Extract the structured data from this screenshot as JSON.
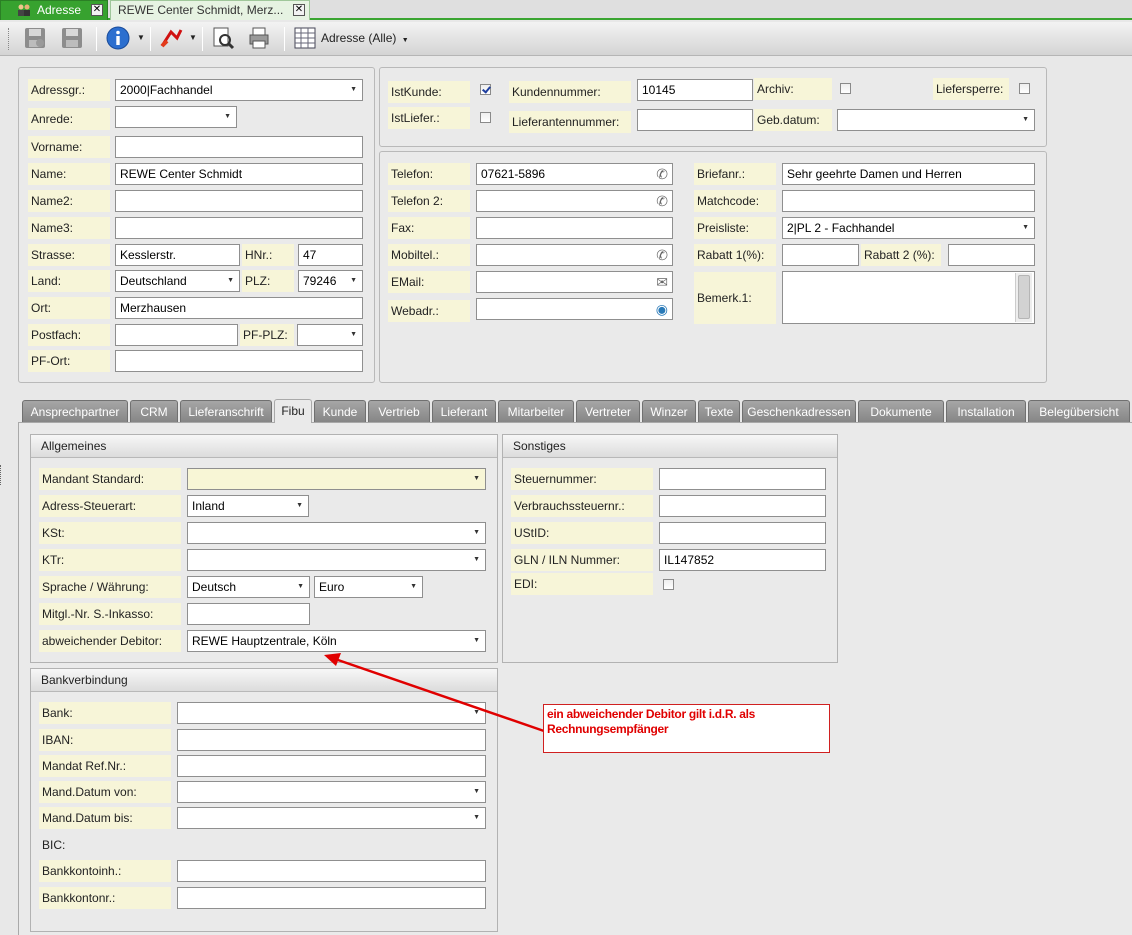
{
  "tabs": {
    "adresse": "Adresse",
    "rewe": "REWE Center Schmidt, Merz..."
  },
  "toolbar": {
    "view_dropdown": "Adresse (Alle)"
  },
  "left": {
    "adressgr_label": "Adressgr.:",
    "adressgr_value": "2000|Fachhandel",
    "anrede_label": "Anrede:",
    "anrede_value": "",
    "vorname_label": "Vorname:",
    "vorname_value": "",
    "name_label": "Name:",
    "name_value": "REWE Center Schmidt",
    "name2_label": "Name2:",
    "name2_value": "",
    "name3_label": "Name3:",
    "name3_value": "",
    "strasse_label": "Strasse:",
    "strasse_value": "Kesslerstr.",
    "hnr_label": "HNr.:",
    "hnr_value": "47",
    "land_label": "Land:",
    "land_value": "Deutschland",
    "plz_label": "PLZ:",
    "plz_value": "79246",
    "ort_label": "Ort:",
    "ort_value": "Merzhausen",
    "postfach_label": "Postfach:",
    "postfach_value": "",
    "pfplz_label": "PF-PLZ:",
    "pfplz_value": "",
    "pfort_label": "PF-Ort:",
    "pfort_value": ""
  },
  "top": {
    "istkunde_label": "IstKunde:",
    "istkunde_checked": true,
    "istliefer_label": "IstLiefer.:",
    "istliefer_checked": false,
    "kundennummer_label": "Kundennummer:",
    "kundennummer_value": "10145",
    "lieferantennummer_label": "Lieferantennummer:",
    "lieferantennummer_value": "",
    "archiv_label": "Archiv:",
    "archiv_checked": false,
    "gebdatum_label": "Geb.datum:",
    "gebdatum_value": "",
    "liefersperre_label": "Liefersperre:",
    "liefersperre_checked": false
  },
  "contact": {
    "telefon_label": "Telefon:",
    "telefon_value": "07621-5896",
    "telefon2_label": "Telefon 2:",
    "telefon2_value": "",
    "fax_label": "Fax:",
    "fax_value": "",
    "mobil_label": "Mobiltel.:",
    "mobil_value": "",
    "email_label": "EMail:",
    "email_value": "",
    "web_label": "Webadr.:",
    "web_value": "",
    "briefanr_label": "Briefanr.:",
    "briefanr_value": "Sehr geehrte Damen und Herren",
    "matchcode_label": "Matchcode:",
    "matchcode_value": "",
    "preisliste_label": "Preisliste:",
    "preisliste_value": "2|PL 2 - Fachhandel",
    "rabatt1_label": "Rabatt 1(%):",
    "rabatt1_value": "",
    "rabatt2_label": "Rabatt 2 (%):",
    "rabatt2_value": "",
    "bemerk_label": "Bemerk.1:",
    "bemerk_value": ""
  },
  "detail_tabs": [
    "Ansprechpartner",
    "CRM",
    "Lieferanschrift",
    "Fibu",
    "Kunde",
    "Vertrieb",
    "Lieferant",
    "Mitarbeiter",
    "Vertreter",
    "Winzer",
    "Texte",
    "Geschenkadressen",
    "Dokumente",
    "Installation",
    "Belegübersicht"
  ],
  "allgemeines": {
    "title": "Allgemeines",
    "mandant_label": "Mandant Standard:",
    "mandant_value": "",
    "steuerart_label": "Adress-Steuerart:",
    "steuerart_value": "Inland",
    "kst_label": "KSt:",
    "kst_value": "",
    "ktr_label": "KTr:",
    "ktr_value": "",
    "sprache_label": "Sprache / Währung:",
    "sprache_value": "Deutsch",
    "waehrung_value": "Euro",
    "mitgl_label": "Mitgl.-Nr. S.-Inkasso:",
    "mitgl_value": "",
    "debitor_label": "abweichender Debitor:",
    "debitor_value": "REWE Hauptzentrale, Köln"
  },
  "sonstiges": {
    "title": "Sonstiges",
    "steuernr_label": "Steuernummer:",
    "steuernr_value": "",
    "verbrauch_label": "Verbrauchssteuernr.:",
    "verbrauch_value": "",
    "ustid_label": "UStID:",
    "ustid_value": "",
    "gln_label": "GLN / ILN Nummer:",
    "gln_value": "IL147852",
    "edi_label": "EDI:",
    "edi_checked": false
  },
  "bank": {
    "title": "Bankverbindung",
    "bank_label": "Bank:",
    "bank_value": "",
    "iban_label": "IBAN:",
    "iban_value": "",
    "mandat_label": "Mandat Ref.Nr.:",
    "mandat_value": "",
    "von_label": "Mand.Datum von:",
    "von_value": "",
    "bis_label": "Mand.Datum bis:",
    "bis_value": "",
    "bic_label": "BIC:",
    "inh_label": "Bankkontoinh.:",
    "inh_value": "",
    "nr_label": "Bankkontonr.:",
    "nr_value": ""
  },
  "annotation": {
    "text": "ein abweichender Debitor gilt i.d.R. als Rechnungsempfänger",
    "color": "#e00000"
  }
}
